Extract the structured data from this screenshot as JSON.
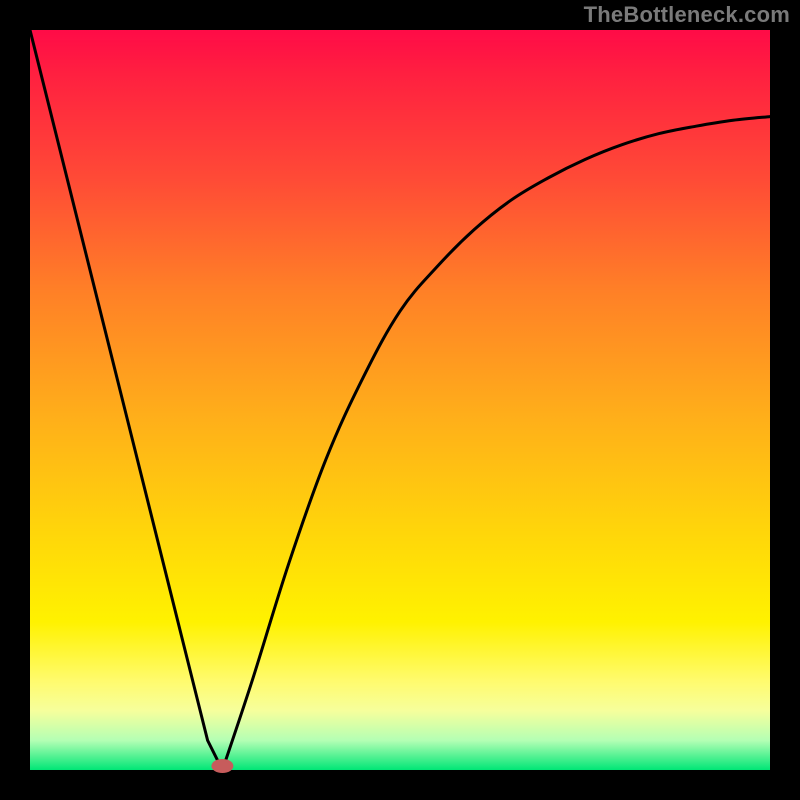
{
  "watermark": {
    "text": "TheBottleneck.com"
  },
  "chart_data": {
    "type": "line",
    "title": "",
    "xlabel": "",
    "ylabel": "",
    "xlim": [
      0,
      100
    ],
    "ylim": [
      0,
      100
    ],
    "grid": false,
    "legend": false,
    "series": [
      {
        "name": "bottleneck-curve",
        "x": [
          0,
          5,
          10,
          15,
          20,
          24,
          26,
          30,
          35,
          40,
          45,
          50,
          55,
          60,
          65,
          70,
          75,
          80,
          85,
          90,
          95,
          100
        ],
        "y": [
          100,
          80,
          60,
          40,
          20,
          4,
          0,
          12,
          28,
          42,
          53,
          62,
          68,
          73,
          77,
          80,
          82.5,
          84.5,
          86,
          87,
          87.8,
          88.3
        ]
      }
    ],
    "marker": {
      "x": 26,
      "y": 0,
      "color": "#c75c5c"
    }
  }
}
